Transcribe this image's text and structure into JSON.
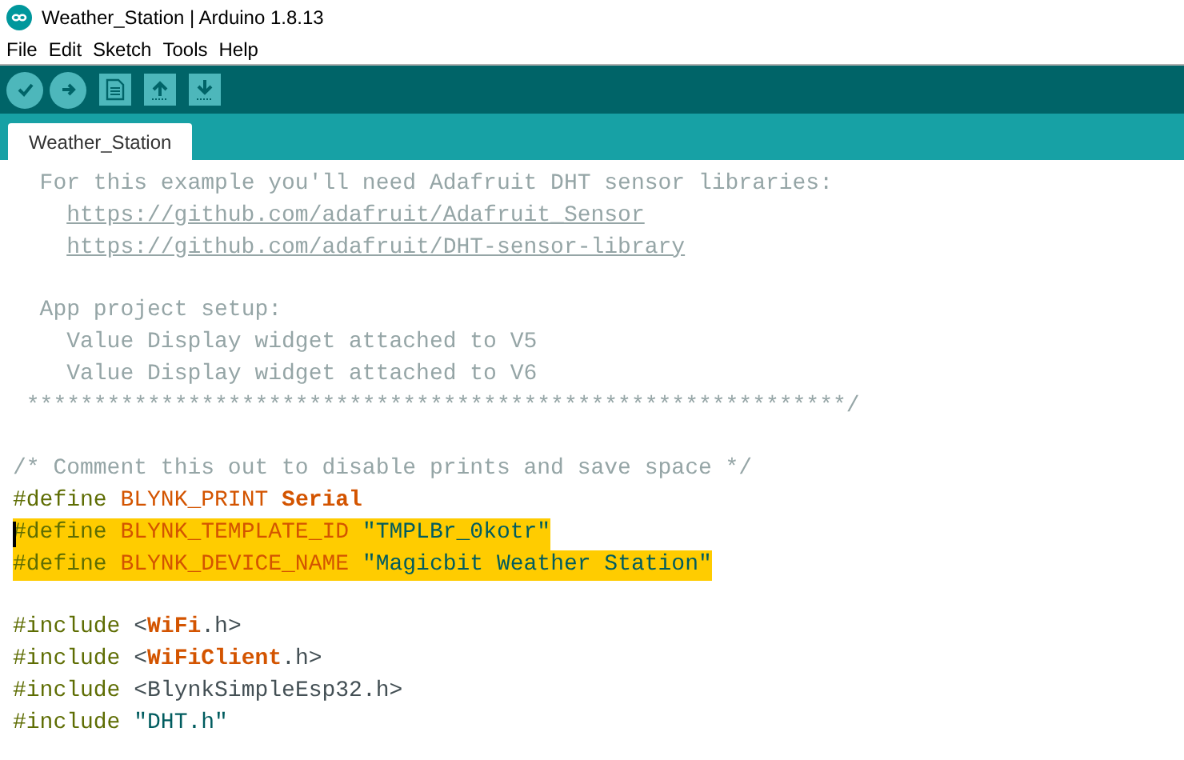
{
  "window": {
    "title": "Weather_Station | Arduino 1.8.13"
  },
  "menu": [
    "File",
    "Edit",
    "Sketch",
    "Tools",
    "Help"
  ],
  "tabs": [
    {
      "label": "Weather_Station",
      "selected": true
    }
  ],
  "code": {
    "lines": [
      {
        "kind": "text",
        "highlighted": false,
        "tokens": [
          {
            "kind": "comment",
            "text": "  For this example you'll need Adafruit DHT sensor libraries:"
          }
        ]
      },
      {
        "kind": "text",
        "highlighted": false,
        "tokens": [
          {
            "kind": "link",
            "text": "https://github.com/adafruit/Adafruit_Sensor"
          }
        ]
      },
      {
        "kind": "text",
        "highlighted": false,
        "tokens": [
          {
            "kind": "link",
            "text": "https://github.com/adafruit/DHT-sensor-library"
          }
        ]
      },
      {
        "kind": "blank"
      },
      {
        "kind": "text",
        "highlighted": false,
        "tokens": [
          {
            "kind": "comment",
            "text": "  App project setup:"
          }
        ]
      },
      {
        "kind": "text",
        "highlighted": false,
        "tokens": [
          {
            "kind": "comment",
            "text": "    Value Display widget attached to V5"
          }
        ]
      },
      {
        "kind": "text",
        "highlighted": false,
        "tokens": [
          {
            "kind": "comment",
            "text": "    Value Display widget attached to V6"
          }
        ]
      },
      {
        "kind": "text",
        "highlighted": false,
        "tokens": [
          {
            "kind": "comment",
            "text": " *************************************************************/"
          }
        ]
      },
      {
        "kind": "blank"
      },
      {
        "kind": "text",
        "highlighted": false,
        "tokens": [
          {
            "kind": "comment",
            "text": "/* Comment this out to disable prints and save space */"
          }
        ]
      },
      {
        "kind": "text",
        "highlighted": false,
        "tokens": [
          {
            "kind": "directive",
            "text": "#define "
          },
          {
            "kind": "constant",
            "text": "BLYNK_PRINT "
          },
          {
            "kind": "type",
            "text": "Serial"
          }
        ]
      },
      {
        "kind": "text",
        "highlighted": true,
        "cursor": true,
        "tokens": [
          {
            "kind": "directive",
            "text": "#define "
          },
          {
            "kind": "constant",
            "text": "BLYNK_TEMPLATE_ID "
          },
          {
            "kind": "string",
            "text": "\"TMPLBr_0kotr\""
          }
        ]
      },
      {
        "kind": "text",
        "highlighted": true,
        "tokens": [
          {
            "kind": "directive",
            "text": "#define "
          },
          {
            "kind": "constant",
            "text": "BLYNK_DEVICE_NAME "
          },
          {
            "kind": "string",
            "text": "\"Magicbit Weather Station\""
          }
        ]
      },
      {
        "kind": "blank"
      },
      {
        "kind": "text",
        "highlighted": false,
        "tokens": [
          {
            "kind": "directive",
            "text": "#include "
          },
          {
            "kind": "plain",
            "text": "<"
          },
          {
            "kind": "type",
            "text": "WiFi"
          },
          {
            "kind": "plain",
            "text": ".h>"
          }
        ]
      },
      {
        "kind": "text",
        "highlighted": false,
        "tokens": [
          {
            "kind": "directive",
            "text": "#include "
          },
          {
            "kind": "plain",
            "text": "<"
          },
          {
            "kind": "type",
            "text": "WiFiClient"
          },
          {
            "kind": "plain",
            "text": ".h>"
          }
        ]
      },
      {
        "kind": "text",
        "highlighted": false,
        "tokens": [
          {
            "kind": "directive",
            "text": "#include "
          },
          {
            "kind": "plain",
            "text": "<BlynkSimpleEsp32.h>"
          }
        ]
      },
      {
        "kind": "text",
        "highlighted": false,
        "tokens": [
          {
            "kind": "directive",
            "text": "#include "
          },
          {
            "kind": "string",
            "text": "\"DHT.h\""
          }
        ]
      }
    ]
  }
}
